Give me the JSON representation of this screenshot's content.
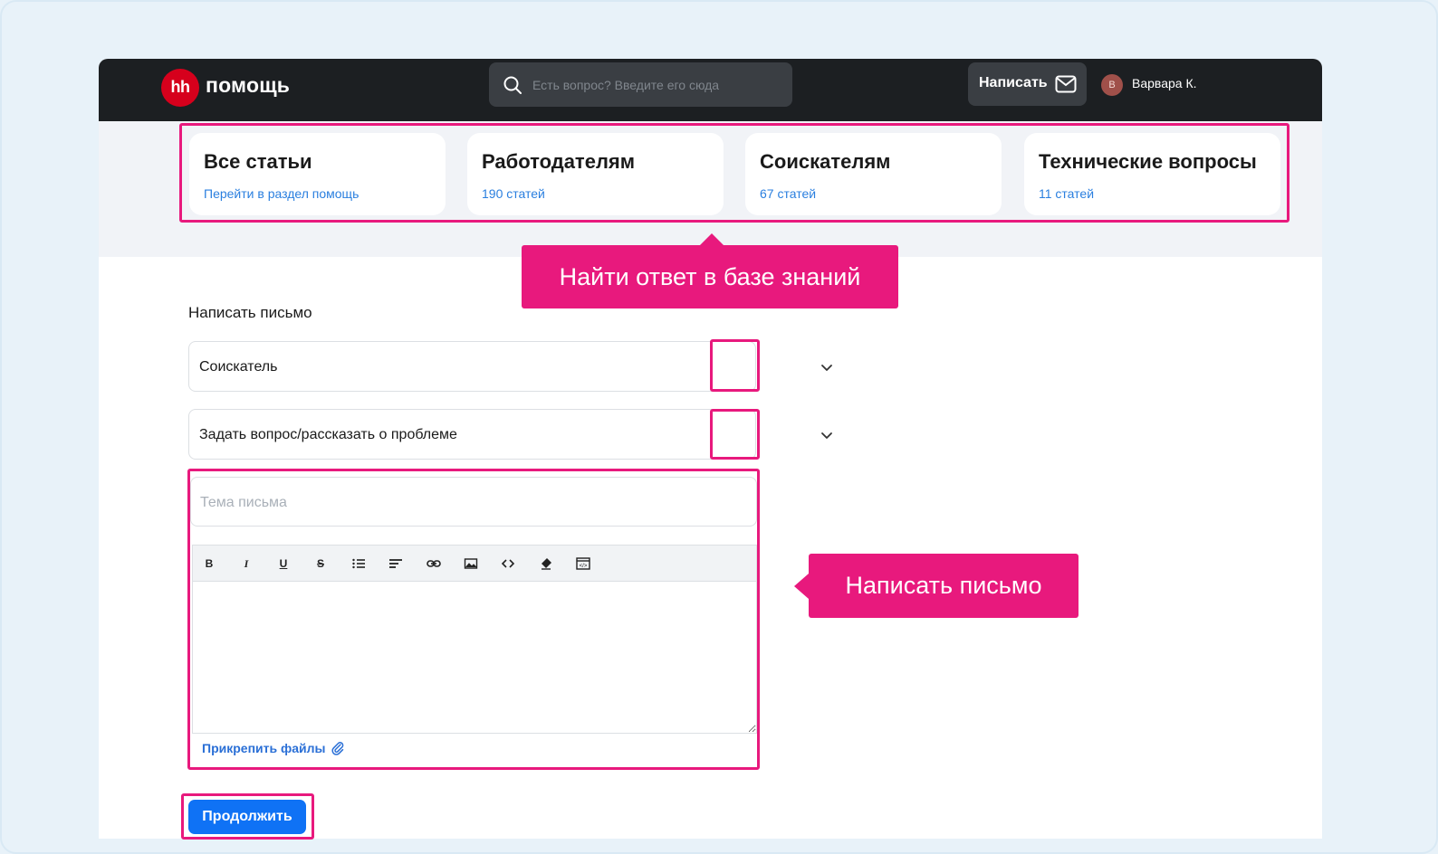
{
  "header": {
    "logo_text": "hh",
    "app_name": "помощь",
    "search_placeholder": "Есть вопрос? Введите его сюда",
    "write_button": "Написать",
    "avatar_initial": "В",
    "user_name": "Варвара К."
  },
  "categories": [
    {
      "title": "Все статьи",
      "subtitle": "Перейти в раздел помощь"
    },
    {
      "title": "Работодателям",
      "subtitle": "190 статей"
    },
    {
      "title": "Соискателям",
      "subtitle": "67 статей"
    },
    {
      "title": "Технические вопросы",
      "subtitle": "11 статей"
    }
  ],
  "form": {
    "title": "Написать письмо",
    "role_select": "Соискатель",
    "topic_select": "Задать вопрос/рассказать о проблеме",
    "subject_placeholder": "Тема письма",
    "toolbar": [
      "bold",
      "italic",
      "underline",
      "strikethrough",
      "bullet-list",
      "align",
      "link",
      "image",
      "code",
      "clear-format",
      "source"
    ],
    "attach_label": "Прикрепить файлы",
    "submit_label": "Продолжить"
  },
  "annotations": {
    "knowledge_base": "Найти ответ в базе знаний",
    "write_letter": "Написать письмо",
    "color": "#e8197d"
  },
  "colors": {
    "header_bg": "#1c1f22",
    "brand_red": "#d6001c",
    "link_blue": "#2a7fdf",
    "button_blue": "#0f72f5"
  }
}
